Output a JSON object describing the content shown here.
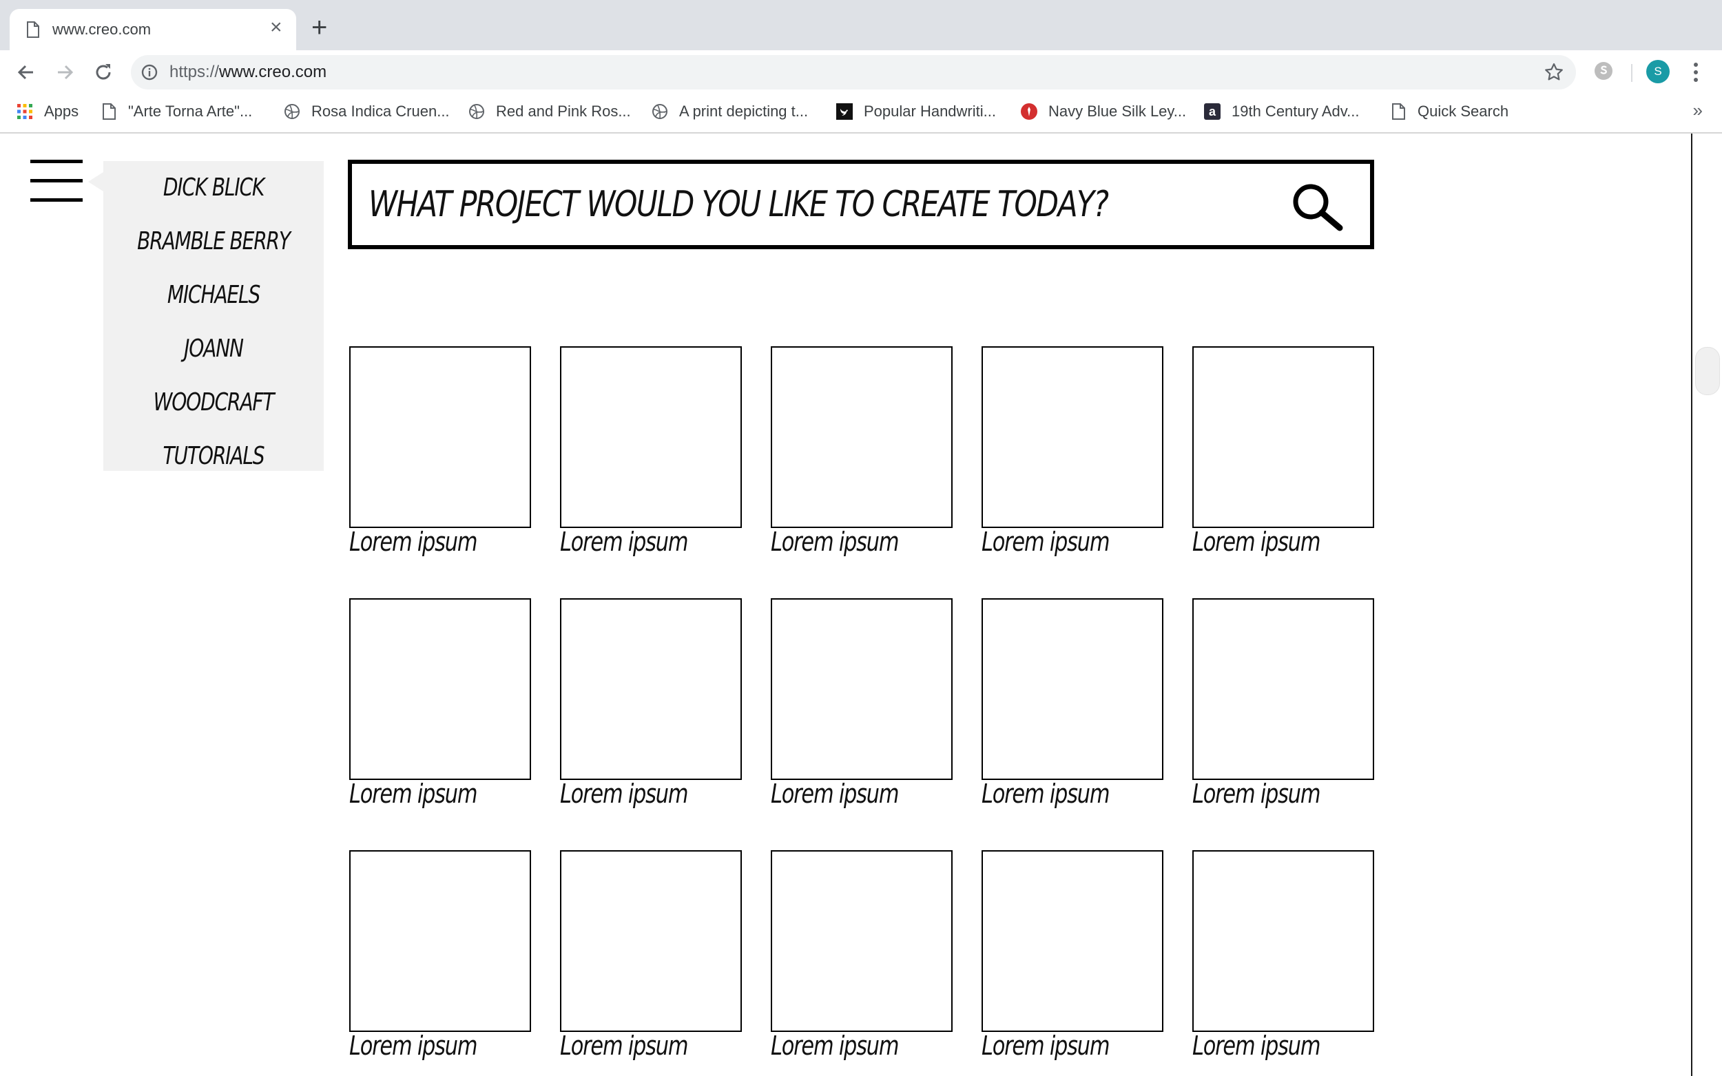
{
  "browser": {
    "tab": {
      "title": "www.creo.com",
      "close": "×"
    },
    "new_tab": "+",
    "address": {
      "scheme": "https://",
      "host": "www.creo.com"
    },
    "profile_initial": "S",
    "bookmarks": [
      {
        "label": "Apps",
        "icon": "apps-grid-icon"
      },
      {
        "label": "\"Arte Torna Arte\"...",
        "icon": "page-icon"
      },
      {
        "label": "Rosa Indica Cruen...",
        "icon": "globe-icon"
      },
      {
        "label": "Red and Pink Ros...",
        "icon": "globe-icon"
      },
      {
        "label": "A print depicting t...",
        "icon": "globe-icon"
      },
      {
        "label": "Popular Handwriti...",
        "icon": "bird-icon"
      },
      {
        "label": "Navy Blue Silk Ley...",
        "icon": "red-circle-icon"
      },
      {
        "label": "19th Century Adv...",
        "icon": "letter-a-icon"
      },
      {
        "label": "Quick Search",
        "icon": "page-icon"
      }
    ],
    "bookmarks_more": "»"
  },
  "menu": {
    "items": [
      "DICK BLICK",
      "BRAMBLE BERRY",
      "MICHAELS",
      "JOANN",
      "WOODCRAFT",
      "TUTORIALS"
    ]
  },
  "search": {
    "placeholder": "WHAT PROJECT WOULD YOU LIKE TO CREATE TODAY?"
  },
  "grid": {
    "rows": [
      [
        "Lorem ipsum",
        "Lorem ipsum",
        "Lorem ipsum",
        "Lorem ipsum",
        "Lorem ipsum"
      ],
      [
        "Lorem ipsum",
        "Lorem ipsum",
        "Lorem ipsum",
        "Lorem ipsum",
        "Lorem ipsum"
      ],
      [
        "Lorem ipsum",
        "Lorem ipsum",
        "Lorem ipsum",
        "Lorem ipsum",
        "Lorem ipsum"
      ]
    ]
  },
  "colors": {
    "tabstrip": "#dee1e6",
    "profile": "#1a9ba6",
    "menu_bg": "#f1f1f1"
  }
}
